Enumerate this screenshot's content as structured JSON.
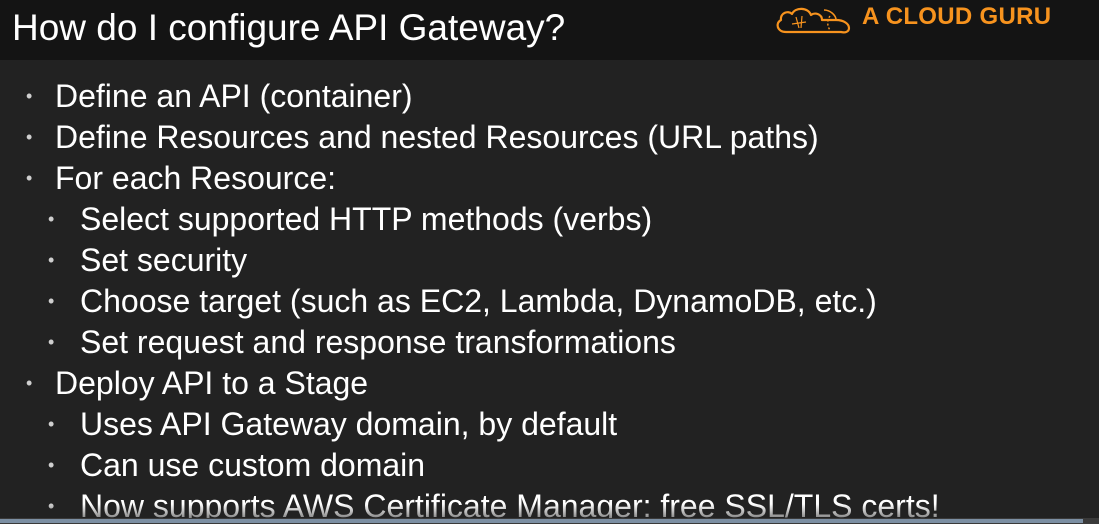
{
  "slide": {
    "title": "How do I configure API Gateway?",
    "brand": {
      "name": "A CLOUD GURU",
      "icon": "cloud-logo-icon",
      "color": "#f7931e"
    },
    "bullets": [
      {
        "level": 1,
        "text": "Define an API (container)"
      },
      {
        "level": 1,
        "text": "Define Resources and nested Resources (URL paths)"
      },
      {
        "level": 1,
        "text": "For each Resource:"
      },
      {
        "level": 2,
        "text": "Select supported HTTP methods (verbs)"
      },
      {
        "level": 2,
        "text": "Set security"
      },
      {
        "level": 2,
        "text": "Choose target (such as EC2, Lambda, DynamoDB, etc.)"
      },
      {
        "level": 2,
        "text": "Set request and response transformations"
      },
      {
        "level": 1,
        "text": "Deploy API to a Stage"
      },
      {
        "level": 2,
        "text": "Uses API Gateway domain, by default"
      },
      {
        "level": 2,
        "text": "Can use custom domain"
      },
      {
        "level": 2,
        "text": "Now supports AWS Certificate Manager: free SSL/TLS certs!"
      }
    ],
    "bullet_glyph": "•"
  },
  "player": {
    "progress_fraction": 0.985
  }
}
